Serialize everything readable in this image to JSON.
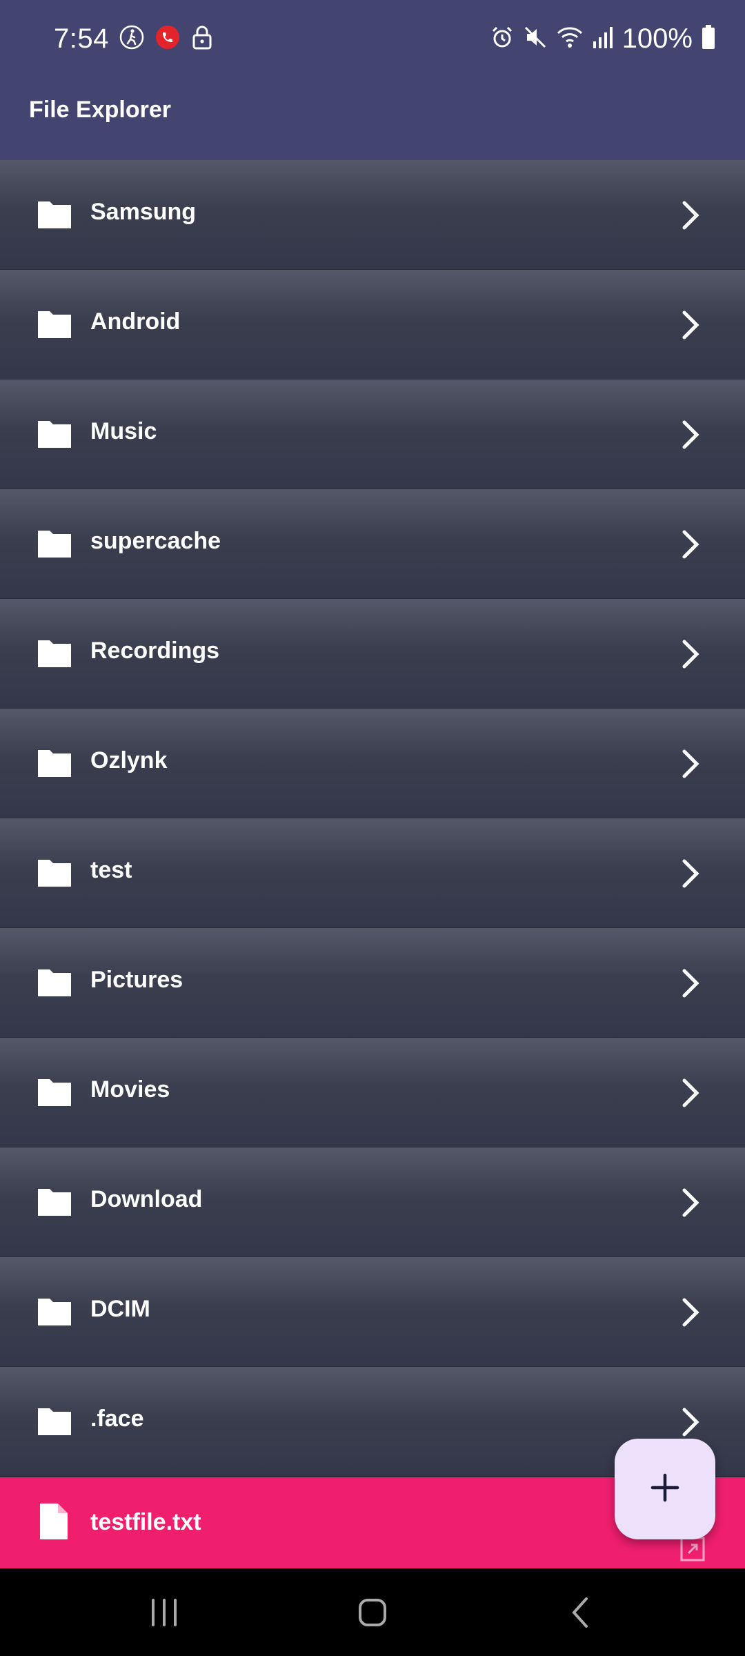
{
  "status_bar": {
    "time": "7:54",
    "battery": "100%",
    "left_icons": [
      "accessibility-icon",
      "call-icon",
      "lock-icon"
    ],
    "right_icons": [
      "alarm-icon",
      "mute-icon",
      "wifi-icon",
      "signal-icon",
      "battery-icon"
    ]
  },
  "app_bar": {
    "title": "File Explorer"
  },
  "folders": [
    {
      "label": "Samsung"
    },
    {
      "label": "Android"
    },
    {
      "label": "Music"
    },
    {
      "label": "supercache"
    },
    {
      "label": "Recordings"
    },
    {
      "label": "Ozlynk"
    },
    {
      "label": "test"
    },
    {
      "label": "Pictures"
    },
    {
      "label": "Movies"
    },
    {
      "label": "Download"
    },
    {
      "label": "DCIM"
    },
    {
      "label": ".face"
    }
  ],
  "file": {
    "label": "testfile.txt"
  },
  "fab": {
    "icon": "plus-icon"
  },
  "nav_bar": {
    "buttons": [
      "recent-apps-icon",
      "home-icon",
      "back-icon"
    ]
  },
  "colors": {
    "app_bar": "#434570",
    "row": "#3b3e4e",
    "file_highlight": "#f01f6e",
    "fab": "#ece0fb",
    "fab_icon": "#1d1b3a"
  }
}
